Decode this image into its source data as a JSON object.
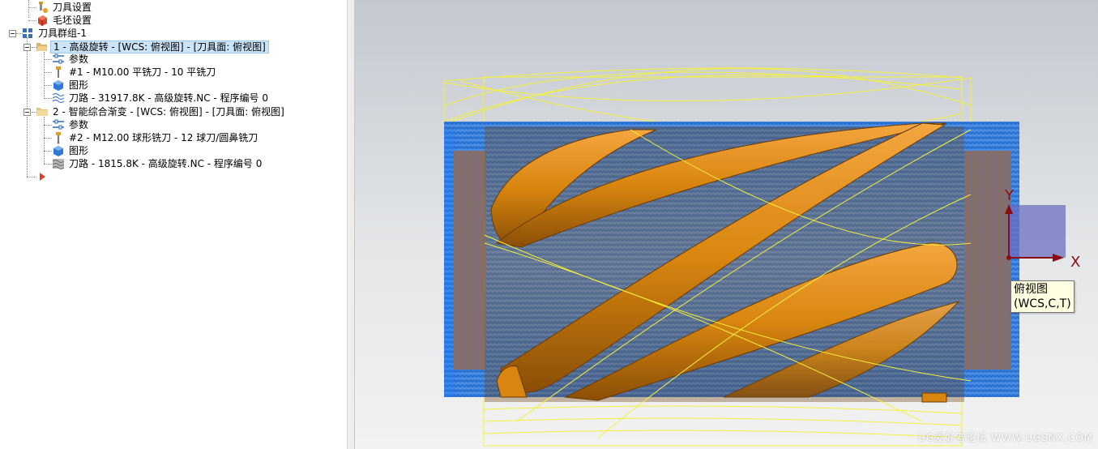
{
  "tree": {
    "items": [
      {
        "label": "刀具设置",
        "icon": "tool-setup-icon"
      },
      {
        "label": "毛坯设置",
        "icon": "stock-setup-icon"
      },
      {
        "label": "刀具群组-1",
        "icon": "tool-group-icon"
      },
      {
        "label": "1 - 高级旋转 - [WCS: 俯视图] - [刀具面: 俯视图]",
        "icon": "folder-open-icon"
      },
      {
        "label": "参数",
        "icon": "parameters-icon"
      },
      {
        "label": "#1 - M10.00 平铣刀 - 10 平铣刀",
        "icon": "end-mill-icon"
      },
      {
        "label": "图形",
        "icon": "geometry-icon"
      },
      {
        "label": "刀路 - 31917.8K - 高级旋转.NC - 程序编号 0",
        "icon": "toolpath-icon"
      },
      {
        "label": "2 - 智能综合渐变 - [WCS: 俯视图] - [刀具面: 俯视图]",
        "icon": "folder-icon"
      },
      {
        "label": "参数",
        "icon": "parameters-icon"
      },
      {
        "label": "#2 - M12.00 球形铣刀 - 12 球刀/圆鼻铣刀",
        "icon": "ball-mill-icon"
      },
      {
        "label": "图形",
        "icon": "geometry-icon"
      },
      {
        "label": "刀路 - 1815.8K - 高级旋转.NC - 程序编号 0",
        "icon": "toolpath-icon"
      },
      {
        "label": "",
        "icon": "insert-arrow-icon"
      }
    ]
  },
  "viewport": {
    "axis_x": "X",
    "axis_y": "Y",
    "view_name": "俯视图",
    "view_info": "(WCS,C,T)",
    "watermark": "UG爱好者论坛 WWW.UGSNX.COM"
  },
  "colors": {
    "toolpath_blue": "#1e7fff",
    "part_orange": "#c8780c",
    "stock_yellow": "#f5f03c",
    "selection": "#cce4f7"
  }
}
